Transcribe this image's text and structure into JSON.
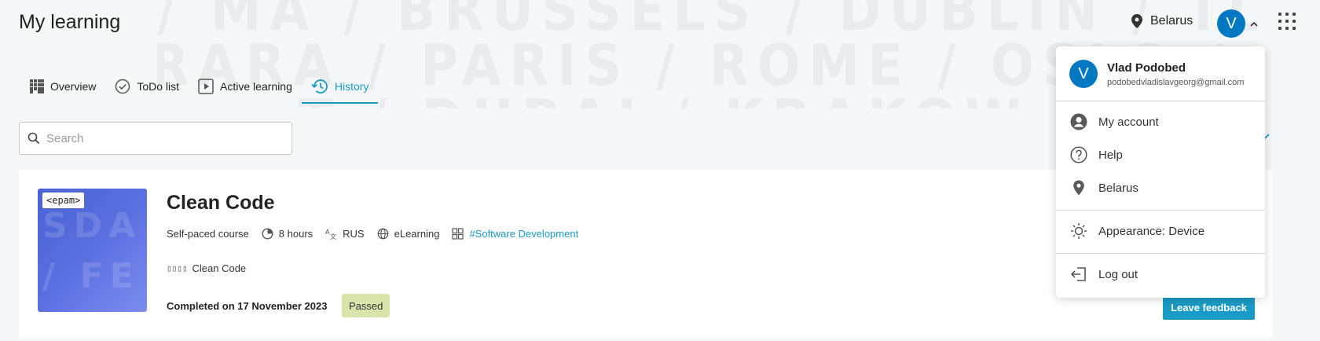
{
  "header": {
    "title": "My learning",
    "country": "Belarus",
    "avatar_initial": "V",
    "watermark_lines": [
      "/ MA / BRUSSELS / DUBLIN / TORONTO",
      "FERRARA / PARIS / ROME / OSLO / FE",
      "T / DUBAI / KRAKOW / TO"
    ]
  },
  "tabs": [
    {
      "label": "Overview",
      "icon": "grid-icon"
    },
    {
      "label": "ToDo list",
      "icon": "check-circle-icon"
    },
    {
      "label": "Active learning",
      "icon": "play-icon"
    },
    {
      "label": "History",
      "icon": "history-icon",
      "active": true
    }
  ],
  "search": {
    "placeholder": "Search",
    "value": ""
  },
  "course": {
    "title": "Clean Code",
    "thumbnail_logo": "<epam>",
    "thumbnail_watermark": [
      "SDA",
      "/ FE"
    ],
    "type": "Self-paced course",
    "duration": "8 hours",
    "language": "RUS",
    "format": "eLearning",
    "tag": "#Software Development",
    "provider_glyphs": "▯▯▯▯",
    "provider": "Clean Code",
    "completed": "Completed on 17 November 2023",
    "status": "Passed",
    "feedback_label": "Leave feedback"
  },
  "menu": {
    "name": "Vlad Podobed",
    "email": "podobedvladislavgeorg@gmail.com",
    "items": [
      {
        "label": "My account",
        "icon": "user-circle-icon"
      },
      {
        "label": "Help",
        "icon": "help-icon"
      },
      {
        "label": "Belarus",
        "icon": "location-pin-icon"
      },
      {
        "label": "Appearance: Device",
        "icon": "sun-icon"
      },
      {
        "label": "Log out",
        "icon": "logout-icon"
      }
    ]
  },
  "colors": {
    "accent": "#1a9bc7",
    "avatar": "#0078c2",
    "passed_badge": "#d7e4aa"
  }
}
